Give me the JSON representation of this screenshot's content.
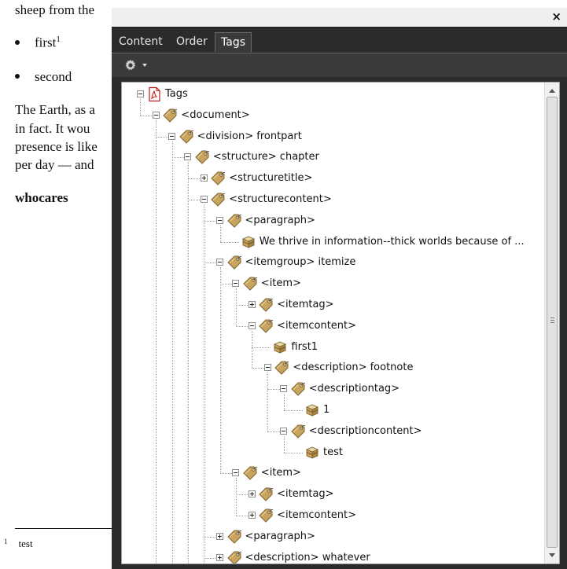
{
  "document": {
    "lines": [
      "sheep from the",
      "The Earth, as a",
      "in fact. It wou",
      "presence is like",
      "per day — and"
    ],
    "bullets": [
      {
        "text": "first",
        "sup": "1"
      },
      {
        "text": "second",
        "sup": ""
      }
    ],
    "heading": "whocares",
    "footnote": {
      "mark": "1",
      "text": "test"
    }
  },
  "panel": {
    "close_label": "×",
    "tabs": [
      "Content",
      "Order",
      "Tags"
    ],
    "active_tab": "Tags",
    "options_icon": "gear-icon"
  },
  "tree": {
    "nodes": [
      {
        "label": "Tags",
        "icon": "pdf-root-icon",
        "expander": "minus"
      },
      {
        "label": "<document>",
        "icon": "tag-icon",
        "expander": "minus"
      },
      {
        "label": "<division> frontpart",
        "icon": "tag-icon",
        "expander": "minus"
      },
      {
        "label": "<structure> chapter",
        "icon": "tag-icon",
        "expander": "minus"
      },
      {
        "label": "<structuretitle>",
        "icon": "tag-icon",
        "expander": "plus"
      },
      {
        "label": "<structurecontent>",
        "icon": "tag-icon",
        "expander": "minus"
      },
      {
        "label": "<paragraph>",
        "icon": "tag-icon",
        "expander": "minus"
      },
      {
        "label": "We thrive in information--thick worlds because of ...",
        "icon": "content-box-icon",
        "expander": "none"
      },
      {
        "label": "<itemgroup> itemize",
        "icon": "tag-icon",
        "expander": "minus"
      },
      {
        "label": "<item>",
        "icon": "tag-icon",
        "expander": "minus"
      },
      {
        "label": "<itemtag>",
        "icon": "tag-icon",
        "expander": "plus"
      },
      {
        "label": "<itemcontent>",
        "icon": "tag-icon",
        "expander": "minus"
      },
      {
        "label": "first1",
        "icon": "content-box-icon",
        "expander": "none"
      },
      {
        "label": "<description> footnote",
        "icon": "tag-icon",
        "expander": "minus"
      },
      {
        "label": "<descriptiontag>",
        "icon": "tag-icon",
        "expander": "minus"
      },
      {
        "label": "1",
        "icon": "content-box-icon",
        "expander": "none"
      },
      {
        "label": "<descriptioncontent>",
        "icon": "tag-icon",
        "expander": "minus"
      },
      {
        "label": "test",
        "icon": "content-box-icon",
        "expander": "none"
      },
      {
        "label": "<item>",
        "icon": "tag-icon",
        "expander": "minus"
      },
      {
        "label": "<itemtag>",
        "icon": "tag-icon",
        "expander": "plus"
      },
      {
        "label": "<itemcontent>",
        "icon": "tag-icon",
        "expander": "plus"
      },
      {
        "label": "<paragraph>",
        "icon": "tag-icon",
        "expander": "plus"
      },
      {
        "label": "<description> whatever",
        "icon": "tag-icon",
        "expander": "plus"
      }
    ]
  },
  "scrollbar": {
    "up_icon": "scroll-up-icon",
    "down_icon": "scroll-down-icon",
    "grip_icon": "scroll-grip-icon"
  }
}
